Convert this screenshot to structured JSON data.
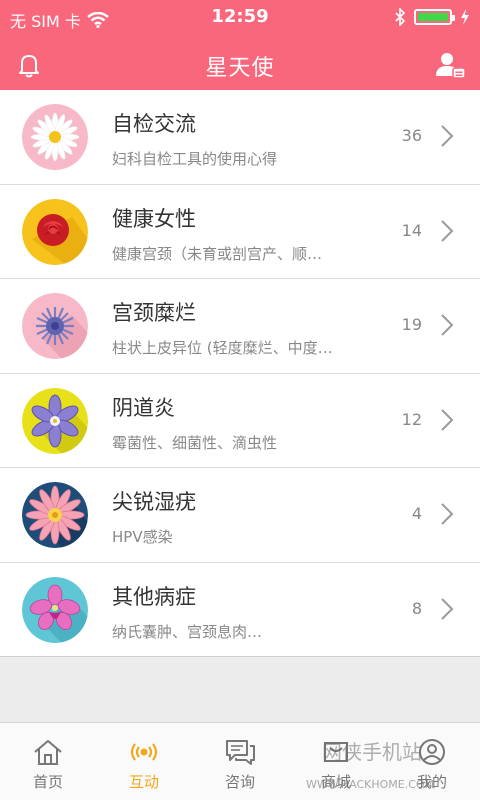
{
  "status_bar": {
    "carrier": "无 SIM 卡",
    "time": "12:59",
    "battery_level": 1.0
  },
  "nav": {
    "title": "星天使",
    "left_icon": "bell-icon",
    "right_icon": "user-settings-icon"
  },
  "items": [
    {
      "title": "自检交流",
      "subtitle": "妇科自检工具的使用心得",
      "count": "36",
      "icon": "white-daisy-icon",
      "bg": "#f7b9c7"
    },
    {
      "title": "健康女性",
      "subtitle": "健康宫颈（未育或剖宫产、顺…",
      "count": "14",
      "icon": "red-rose-icon",
      "bg": "#f6c21b"
    },
    {
      "title": "宫颈糜烂",
      "subtitle": "柱状上皮异位 (轻度糜烂、中度…",
      "count": "19",
      "icon": "blue-flower-icon",
      "bg": "#f7b9c7"
    },
    {
      "title": "阴道炎",
      "subtitle": "霉菌性、细菌性、滴虫性",
      "count": "12",
      "icon": "purple-flower-icon",
      "bg": "#e8e11a"
    },
    {
      "title": "尖锐湿疣",
      "subtitle": "HPV感染",
      "count": "4",
      "icon": "pink-lotus-icon",
      "bg": "#1e4d7a"
    },
    {
      "title": "其他病症",
      "subtitle": "纳氏囊肿、宫颈息肉…",
      "count": "8",
      "icon": "orchid-icon",
      "bg": "#5fc6d6"
    }
  ],
  "tabs": [
    {
      "label": "首页",
      "icon": "home-icon",
      "active": false
    },
    {
      "label": "互动",
      "icon": "broadcast-icon",
      "active": true
    },
    {
      "label": "咨询",
      "icon": "chat-icon",
      "active": false
    },
    {
      "label": "商城",
      "icon": "shop-icon",
      "active": false
    },
    {
      "label": "我的",
      "icon": "profile-icon",
      "active": false
    }
  ],
  "watermark": {
    "text": "网侠手机站",
    "url": "WWW.HACKHOME.COM"
  },
  "colors": {
    "header": "#f9677c",
    "accent": "#f0a81c"
  }
}
